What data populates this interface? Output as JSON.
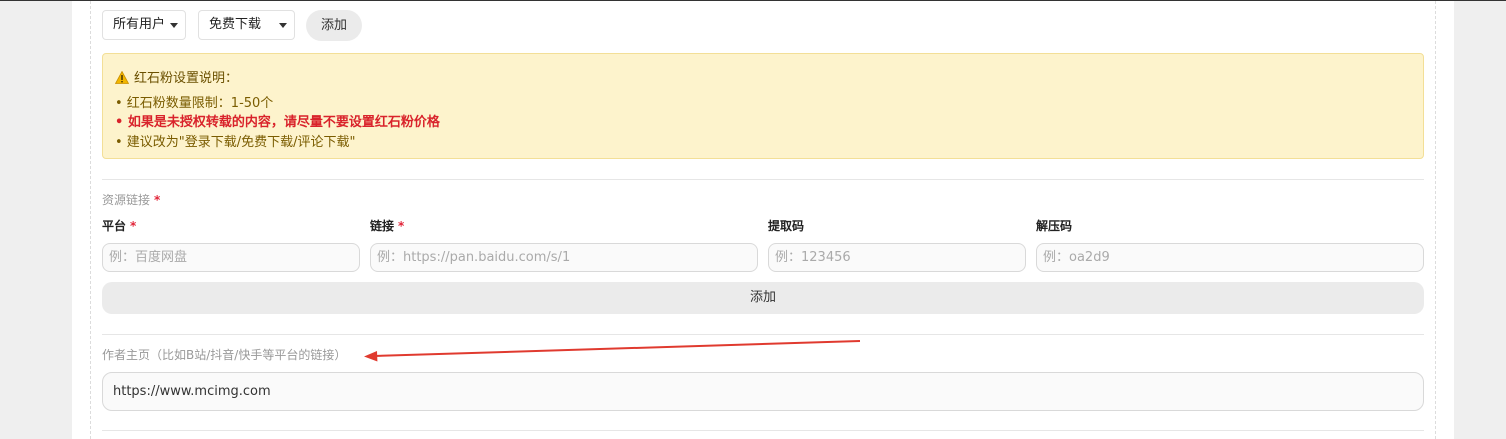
{
  "filters": {
    "user_select": "所有用户",
    "download_select": "免费下载",
    "add_label": "添加"
  },
  "notice": {
    "title": "红石粉设置说明：",
    "lines": [
      "• 红石粉数量限制：1-50个",
      "• 如果是未授权转载的内容，请尽量不要设置红石粉价格",
      "• 建议改为\"登录下载/免费下载/评论下载\""
    ],
    "warning_color": "#d9232b"
  },
  "resource": {
    "section_label": "资源链接",
    "required_mark": "*",
    "platform_label": "平台",
    "link_label": "链接",
    "code_label": "提取码",
    "unzip_label": "解压码",
    "platform_placeholder": "例：百度网盘",
    "link_placeholder": "例：https://pan.baidu.com/s/1",
    "code_placeholder": "例：123456",
    "unzip_placeholder": "例：oa2d9",
    "add_label": "添加"
  },
  "author": {
    "label": "作者主页（比如B站/抖音/快手等平台的链接）",
    "value": "https://www.mcimg.com"
  },
  "icons": {
    "warning": "warning-triangle-icon",
    "caret": "chevron-down-icon",
    "annotation": "red-arrow-annotation"
  }
}
